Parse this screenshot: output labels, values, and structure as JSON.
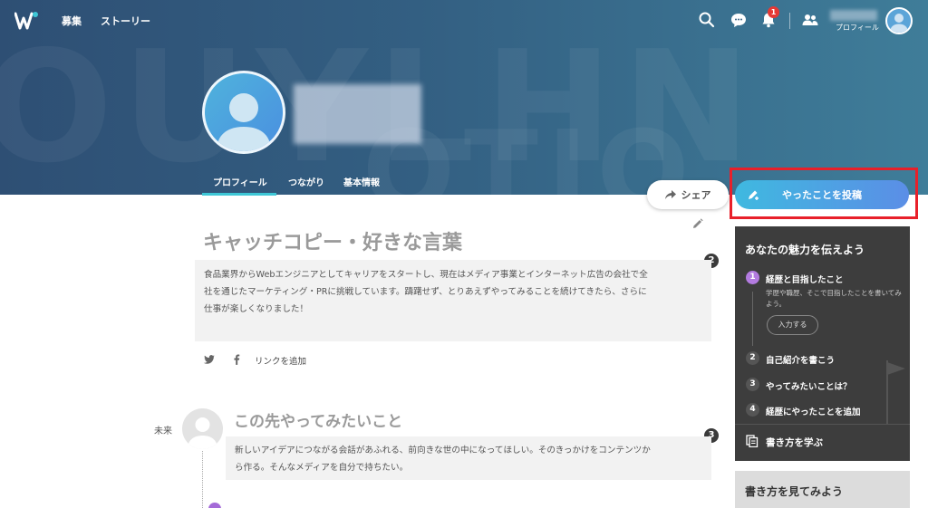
{
  "nav": {
    "links": [
      "募集",
      "ストーリー"
    ],
    "notification_count": "1",
    "profile_label": "プロフィール"
  },
  "profile": {
    "tabs": [
      "プロフィール",
      "つながり",
      "基本情報"
    ]
  },
  "actions": {
    "share_label": "シェア",
    "post_label": "やったことを投稿"
  },
  "catchcopy": {
    "title": "キャッチコピー・好きな言葉",
    "step_number": "2",
    "body_lines": [
      "食品業界からWebエンジニアとしてキャリアをスタートし、現在はメディア事業とインターネット広告の会社で全",
      "社を通じたマーケティング・PRに挑戦しています。躊躇せず、とりあえずやってみることを続けてきたら、さらに",
      "仕事が楽しくなりました！"
    ],
    "add_link_label": "リンクを追加"
  },
  "future": {
    "label": "未来",
    "title": "この先やってみたいこと",
    "step_number": "3",
    "body_lines": [
      "新しいアイデアにつながる会話があふれる、前向きな世の中になってほしい。そのきっかけをコンテンツか",
      "ら作る。そんなメディアを自分で持ちたい。"
    ]
  },
  "guide": {
    "title": "あなたの魅力を伝えよう",
    "steps": [
      {
        "num": "1",
        "label": "経歴と目指したこと",
        "desc": "学歴や職歴、そこで目指したことを書いてみよう。",
        "button": "入力する"
      },
      {
        "num": "2",
        "label": "自己紹介を書こう"
      },
      {
        "num": "3",
        "label": "やってみたいことは？"
      },
      {
        "num": "4",
        "label": "経歴にやったことを追加"
      }
    ],
    "learn_label": "書き方を学ぶ"
  },
  "howto": {
    "label": "書き方を見てみよう"
  },
  "colors": {
    "accent_teal": "#3ec7d6",
    "post_gradient_start": "#3fb9e0",
    "post_gradient_end": "#5b8ee6",
    "highlight_red": "#e8202a",
    "step_active": "#b37be0"
  }
}
